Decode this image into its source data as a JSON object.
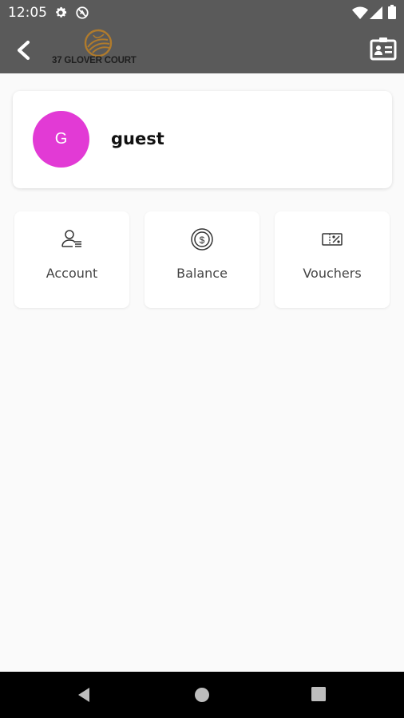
{
  "status_bar": {
    "time": "12:05",
    "icons": [
      "settings-icon",
      "no-data-icon",
      "wifi-icon",
      "signal-icon",
      "battery-icon"
    ]
  },
  "app_bar": {
    "brand": "37 GLOVER COURT",
    "back_icon": "chevron-left-icon",
    "card_icon": "id-card-icon",
    "logo_color": "#b07b2c"
  },
  "profile": {
    "initial": "G",
    "name": "guest",
    "avatar_color": "#e23ad5"
  },
  "tiles": [
    {
      "label": "Account",
      "icon": "account-icon"
    },
    {
      "label": "Balance",
      "icon": "balance-icon"
    },
    {
      "label": "Vouchers",
      "icon": "voucher-icon"
    }
  ],
  "nav_bar": {
    "icons": [
      "back-triangle-icon",
      "home-circle-icon",
      "recents-square-icon"
    ]
  }
}
